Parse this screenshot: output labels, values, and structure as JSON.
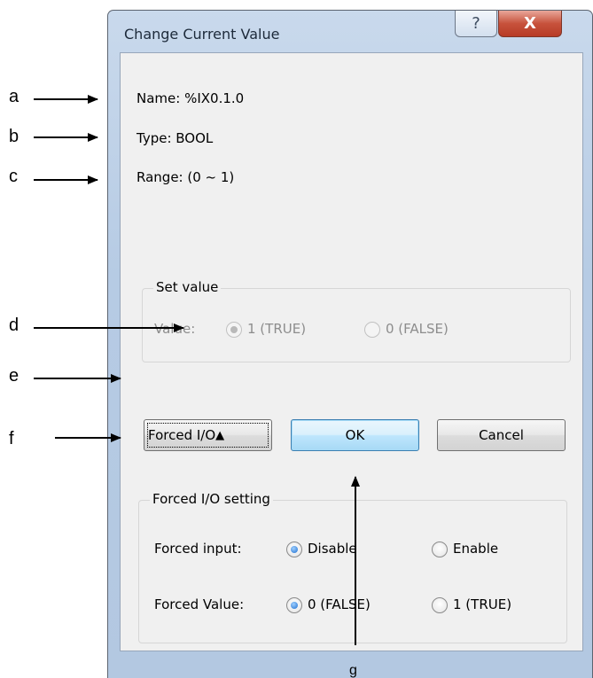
{
  "callouts": {
    "a": "a",
    "b": "b",
    "c": "c",
    "d": "d",
    "e": "e",
    "f": "f",
    "g": "g"
  },
  "window": {
    "title": "Change Current Value",
    "help_glyph": "?",
    "close_glyph": "X"
  },
  "info": {
    "name": "Name:  %IX0.1.0",
    "type": "Type:  BOOL",
    "range": "Range: (0 ~ 1)"
  },
  "set_value": {
    "group_title": "Set value",
    "value_label": "Value:",
    "option_true": "1 (TRUE)",
    "option_false": "0 (FALSE)",
    "selected": "1 (TRUE)",
    "enabled": false
  },
  "buttons": {
    "forced_io": "Forced I/O",
    "ok": "OK",
    "cancel": "Cancel"
  },
  "forced_io_setting": {
    "group_title": "Forced I/O setting",
    "forced_input_label": "Forced input:",
    "forced_input_disable": "Disable",
    "forced_input_enable": "Enable",
    "forced_input_selected": "Disable",
    "forced_value_label": "Forced Value:",
    "forced_value_false": "0 (FALSE)",
    "forced_value_true": "1 (TRUE)",
    "forced_value_selected": "0 (FALSE)"
  },
  "colors": {
    "accent": "#1f6fd0",
    "frame": "#b6cbe4",
    "close": "#c7523c"
  }
}
